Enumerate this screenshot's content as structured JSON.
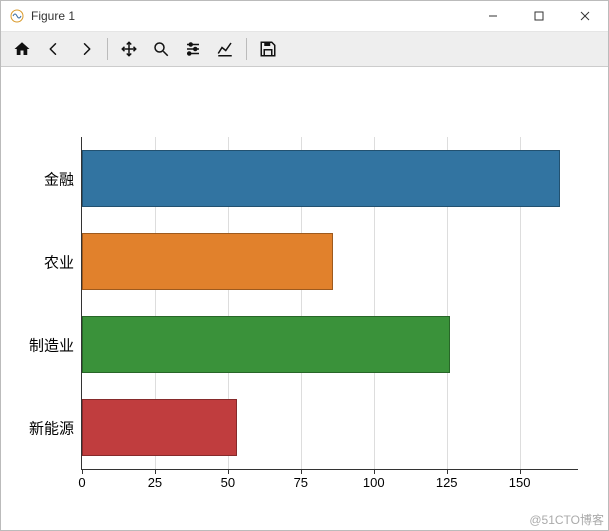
{
  "window": {
    "title": "Figure 1"
  },
  "toolbar": {
    "home": "home-icon",
    "back": "back-icon",
    "forward": "forward-icon",
    "pan": "pan-icon",
    "zoom": "zoom-icon",
    "subplots": "sliders-icon",
    "axes": "axes-icon",
    "save": "save-icon"
  },
  "chart_data": {
    "type": "bar",
    "orientation": "horizontal",
    "categories": [
      "金融",
      "农业",
      "制造业",
      "新能源"
    ],
    "values": [
      164,
      86,
      126,
      53
    ],
    "colors": [
      "#3274a1",
      "#e1812c",
      "#3a923a",
      "#c03d3e"
    ],
    "xlabel": "",
    "ylabel": "",
    "xlim": [
      0,
      170
    ],
    "xticks": [
      0,
      25,
      50,
      75,
      100,
      125,
      150
    ],
    "xtick_labels": [
      "0",
      "25",
      "50",
      "75",
      "100",
      "125",
      "150"
    ]
  },
  "watermark": "@51CTO博客"
}
